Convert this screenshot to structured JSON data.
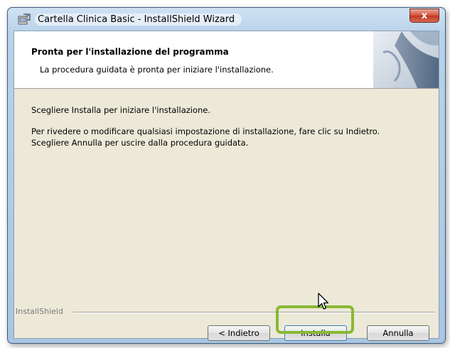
{
  "window": {
    "title": "Cartella Clinica Basic - InstallShield Wizard",
    "close_label": "x"
  },
  "header": {
    "title": "Pronta per l'installazione del programma",
    "description": "La procedura guidata è pronta per iniziare l'installazione."
  },
  "body": {
    "line1": "Scegliere Installa per iniziare l'installazione.",
    "line2": "Per rivedere o modificare qualsiasi impostazione di installazione, fare clic su Indietro.",
    "line3": "Scegliere Annulla per uscire dalla procedura guidata."
  },
  "footer": {
    "brand": "InstallShield"
  },
  "buttons": {
    "back": "< Indietro",
    "install": "Installa",
    "cancel": "Annulla"
  },
  "colors": {
    "highlight": "#8ab833",
    "close_button": "#d5533f"
  }
}
